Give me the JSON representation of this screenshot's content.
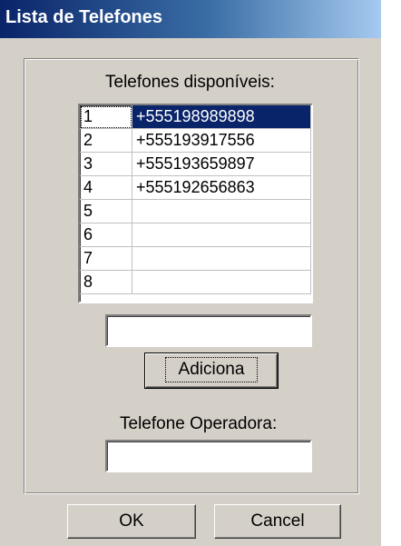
{
  "window": {
    "title": "Lista de Telefones"
  },
  "list": {
    "label": "Telefones disponíveis:",
    "rows": [
      {
        "num": "1",
        "phone": "+555198989898"
      },
      {
        "num": "2",
        "phone": "+555193917556"
      },
      {
        "num": "3",
        "phone": "+555193659897"
      },
      {
        "num": "4",
        "phone": "+555192656863"
      },
      {
        "num": "5",
        "phone": ""
      },
      {
        "num": "6",
        "phone": ""
      },
      {
        "num": "7",
        "phone": ""
      },
      {
        "num": "8",
        "phone": ""
      }
    ],
    "selected_row": "1"
  },
  "new_phone_input": {
    "value": ""
  },
  "add_button": {
    "label": "Adiciona"
  },
  "operator": {
    "label": "Telefone Operadora:",
    "value": ""
  },
  "buttons": {
    "ok_label": "OK",
    "cancel_label": "Cancel"
  }
}
